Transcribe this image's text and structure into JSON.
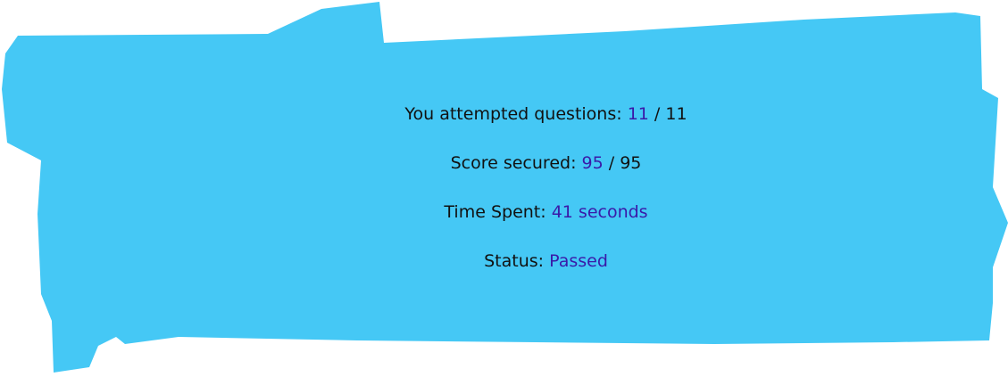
{
  "colors": {
    "background_brush": "#45c8f5",
    "highlight": "#3a1aa8",
    "text": "#111111"
  },
  "results": {
    "attempted": {
      "label": "You attempted questions:",
      "value": "11",
      "separator": "/",
      "total": "11"
    },
    "score": {
      "label": "Score secured:",
      "value": "95",
      "separator": "/",
      "total": "95"
    },
    "time": {
      "label": "Time Spent:",
      "value": "41 seconds"
    },
    "status": {
      "label": "Status:",
      "value": "Passed"
    }
  }
}
